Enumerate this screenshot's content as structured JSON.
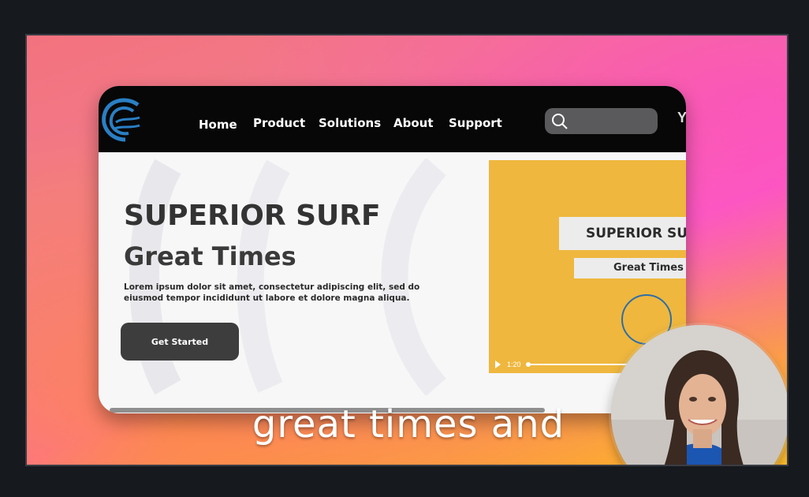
{
  "nav": {
    "items": [
      "Home",
      "Product",
      "Solutions",
      "About",
      "Support"
    ],
    "extra": "Y"
  },
  "hero": {
    "title": "SUPERIOR SURF",
    "subtitle": "Great Times",
    "body": "Lorem ipsum dolor sit amet, consectetur adipiscing elit, sed do eiusmod tempor incididunt ut labore et dolore magna aliqua.",
    "cta": "Get Started"
  },
  "video": {
    "title": "SUPERIOR SU",
    "subtitle": "Great Times",
    "time": "1:20"
  },
  "caption": "great times and",
  "colors": {
    "navbar": "#070707",
    "accent_video": "#efb73e",
    "logo": "#2a7fc4",
    "cta": "#3d3d3d"
  },
  "icons": [
    "wave-logo-icon",
    "search-icon",
    "play-icon"
  ]
}
